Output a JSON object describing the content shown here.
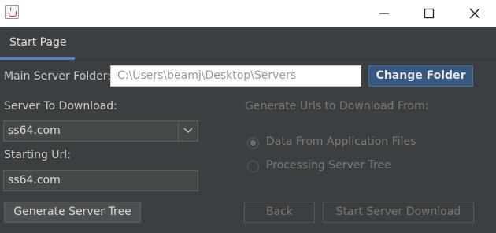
{
  "titlebar": {
    "app_icon": "java-cup-icon",
    "controls": [
      "minimize-icon",
      "maximize-icon",
      "close-icon"
    ]
  },
  "tabs": [
    {
      "label": "Start Page",
      "active": true
    }
  ],
  "form": {
    "main_folder_label": "Main Server Folder:",
    "main_folder_value": "C:\\Users\\beamj\\Desktop\\Servers",
    "change_folder_label": "Change Folder",
    "server_to_download_label": "Server To Download:",
    "server_to_download_value": "ss64.com",
    "starting_url_label": "Starting Url:",
    "starting_url_value": "ss64.com",
    "generate_tree_label": "Generate Server Tree"
  },
  "generate_urls": {
    "heading": "Generate Urls to Download From:",
    "options": [
      {
        "label": "Data From Application Files",
        "checked": true
      },
      {
        "label": "Processing Server Tree",
        "checked": false
      }
    ]
  },
  "actions": {
    "back_label": "Back",
    "start_download_label": "Start Server Download"
  },
  "colors": {
    "background": "#3c3f41",
    "accent": "#4a88c7",
    "primary_button": "#365880"
  }
}
